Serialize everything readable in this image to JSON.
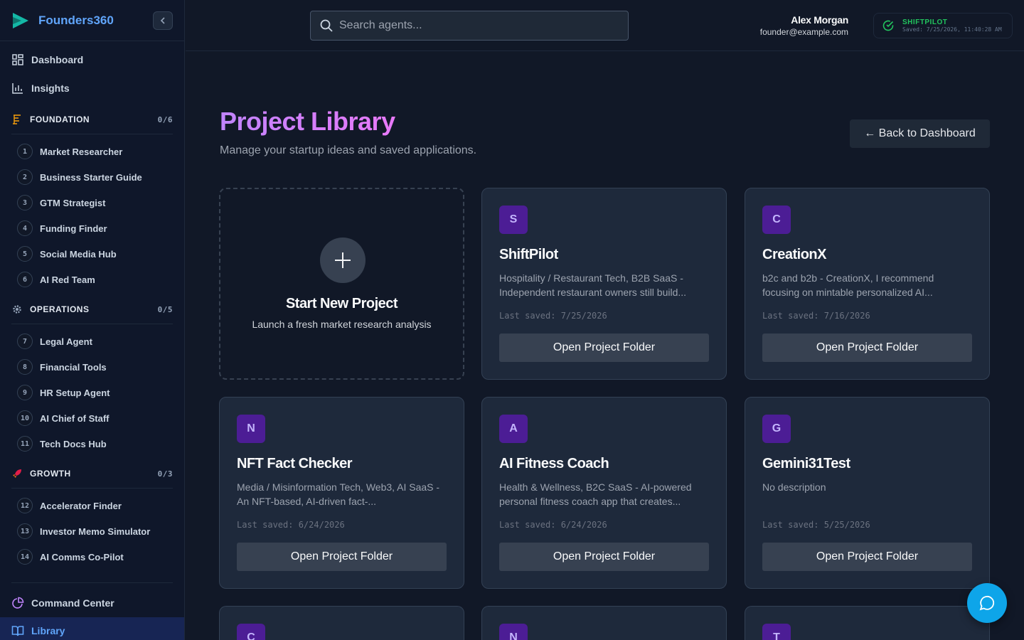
{
  "brand": {
    "name": "Founders360",
    "accent": "#60a5fa"
  },
  "nav": {
    "dashboard": "Dashboard",
    "insights": "Insights",
    "command_center": "Command Center",
    "library": "Library"
  },
  "sections": [
    {
      "title": "FOUNDATION",
      "count": "0/6",
      "icon": "foundation-icon",
      "agents": [
        {
          "num": "1",
          "label": "Market Researcher"
        },
        {
          "num": "2",
          "label": "Business Starter Guide"
        },
        {
          "num": "3",
          "label": "GTM Strategist"
        },
        {
          "num": "4",
          "label": "Funding Finder"
        },
        {
          "num": "5",
          "label": "Social Media Hub"
        },
        {
          "num": "6",
          "label": "AI Red Team"
        }
      ]
    },
    {
      "title": "OPERATIONS",
      "count": "0/5",
      "icon": "gear-icon",
      "agents": [
        {
          "num": "7",
          "label": "Legal Agent"
        },
        {
          "num": "8",
          "label": "Financial Tools"
        },
        {
          "num": "9",
          "label": "HR Setup Agent"
        },
        {
          "num": "10",
          "label": "AI Chief of Staff"
        },
        {
          "num": "11",
          "label": "Tech Docs Hub"
        }
      ]
    },
    {
      "title": "GROWTH",
      "count": "0/3",
      "icon": "rocket-icon",
      "agents": [
        {
          "num": "12",
          "label": "Accelerator Finder"
        },
        {
          "num": "13",
          "label": "Investor Memo Simulator"
        },
        {
          "num": "14",
          "label": "AI Comms Co-Pilot"
        }
      ]
    }
  ],
  "header": {
    "search_placeholder": "Search agents...",
    "user_name": "Alex Morgan",
    "user_email": "founder@example.com",
    "saved_title": "SHIFTPILOT",
    "saved_time": "Saved: 7/25/2026, 11:40:28 AM"
  },
  "main": {
    "title": "Project Library",
    "subtitle": "Manage your startup ideas and saved applications.",
    "back_label": "← Back to Dashboard",
    "new_project": {
      "title": "Start New Project",
      "desc": "Launch a fresh market research analysis"
    },
    "open_label": "Open Project Folder",
    "projects": [
      {
        "initial": "S",
        "name": "ShiftPilot",
        "desc": "Hospitality / Restaurant Tech, B2B SaaS - Independent restaurant owners still build...",
        "saved": "Last saved: 7/25/2026"
      },
      {
        "initial": "C",
        "name": "CreationX",
        "desc": "b2c and b2b - CreationX, I recommend focusing on mintable personalized AI...",
        "saved": "Last saved: 7/16/2026"
      },
      {
        "initial": "N",
        "name": "NFT Fact Checker",
        "desc": "Media / Misinformation Tech, Web3, AI SaaS - An NFT-based, AI-driven fact-...",
        "saved": "Last saved: 6/24/2026"
      },
      {
        "initial": "A",
        "name": "AI Fitness Coach",
        "desc": "Health & Wellness, B2C SaaS - AI-powered personal fitness coach app that creates...",
        "saved": "Last saved: 6/24/2026"
      },
      {
        "initial": "G",
        "name": "Gemini31Test",
        "desc": "No description",
        "saved": "Last saved: 5/25/2026"
      },
      {
        "initial": "C"
      },
      {
        "initial": "N"
      },
      {
        "initial": "T"
      }
    ]
  }
}
